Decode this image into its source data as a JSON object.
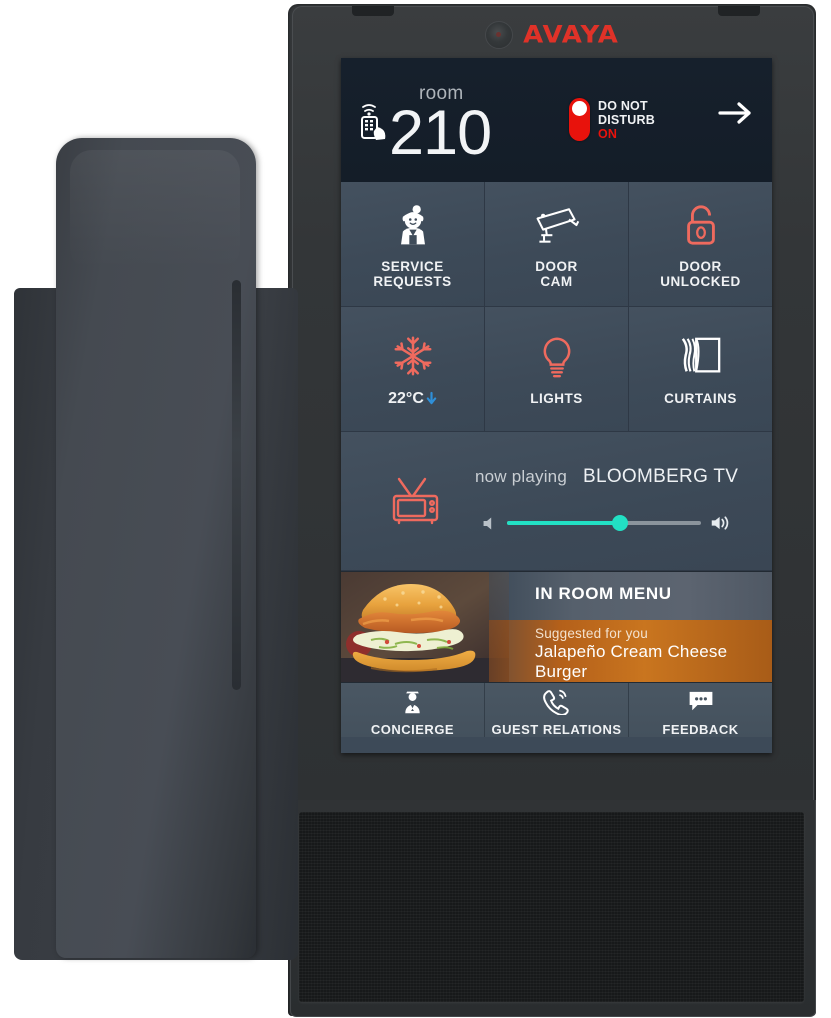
{
  "device": {
    "brand": "AVAYA",
    "camera_icon": "camera-lens-icon",
    "handset_name": "phone-handset",
    "speaker_name": "speaker-grille"
  },
  "screen": {
    "header": {
      "room_icon": "remote-control-in-hand-icon",
      "room_label": "room",
      "room_number": "210",
      "dnd": {
        "line1": "DO NOT",
        "line2": "DISTURB",
        "state": "ON",
        "toggle_color": "#e8120c"
      },
      "next_arrow_icon": "arrow-right-icon"
    },
    "grid": [
      {
        "icon": "maid-service-icon",
        "icon_color": "#ffffff",
        "label": "SERVICE\nREQUESTS",
        "label_line1": "SERVICE",
        "label_line2": "REQUESTS"
      },
      {
        "icon": "security-camera-icon",
        "icon_color": "#ffffff",
        "label": "DOOR\nCAM",
        "label_line1": "DOOR",
        "label_line2": "CAM"
      },
      {
        "icon": "open-padlock-icon",
        "icon_color": "#ef6a5e",
        "label": "DOOR\nUNLOCKED",
        "label_line1": "DOOR",
        "label_line2": "UNLOCKED"
      },
      {
        "icon": "snowflake-icon",
        "icon_color": "#ef6a5e",
        "label": "22°C",
        "temperature": "22°C",
        "trend_icon": "arrow-down-icon",
        "trend_color": "#2f8fd8"
      },
      {
        "icon": "light-bulb-icon",
        "icon_color": "#ef6a5e",
        "label": "LIGHTS"
      },
      {
        "icon": "curtains-icon",
        "icon_color": "#ffffff",
        "label": "CURTAINS"
      }
    ],
    "media": {
      "tv_icon": "retro-tv-icon",
      "tv_icon_color": "#ef6a5e",
      "now_playing_label": "now playing",
      "channel": "BLOOMBERG TV",
      "volume_percent": 58,
      "volume_low_icon": "volume-low-icon",
      "volume_high_icon": "volume-high-icon",
      "slider_color": "#22e0c4"
    },
    "menu_banner": {
      "photo_alt": "burger-photo",
      "title": "IN ROOM MENU",
      "subtitle": "Suggested for you",
      "item": "Jalapeño Cream Cheese Burger"
    },
    "bottom_nav": [
      {
        "icon": "concierge-person-icon",
        "label": "CONCIERGE"
      },
      {
        "icon": "phone-ring-icon",
        "label": "GUEST RELATIONS"
      },
      {
        "icon": "chat-bubble-icon",
        "label": "FEEDBACK"
      }
    ]
  }
}
